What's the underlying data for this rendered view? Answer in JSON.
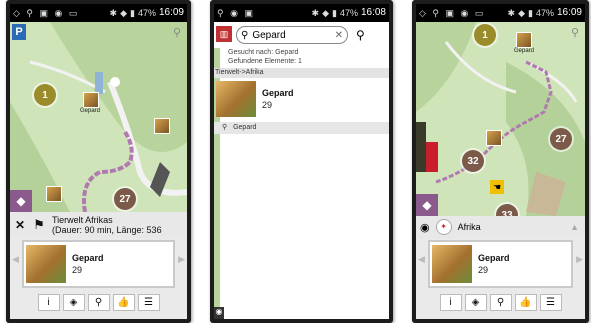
{
  "panel1": {
    "status": {
      "time": "16:09",
      "battery": "47%"
    },
    "map": {
      "markers": [
        "1",
        "27"
      ],
      "poi_label": "Gepard"
    },
    "route": {
      "close": "✕",
      "title": "Tierwelt Afrikas",
      "details": "(Dauer: 90 min, Länge: 536"
    },
    "card": {
      "name": "Gepard",
      "number": "29"
    },
    "toolbar": [
      "i",
      "◈",
      "⚲",
      "👍",
      "☰"
    ]
  },
  "panel2": {
    "status": {
      "time": "16:08",
      "battery": "47%"
    },
    "search": {
      "value": "Gepard"
    },
    "info": {
      "line1": "Gesucht nach: Gepard",
      "line2": "Gefundene Elemente: 1"
    },
    "section": "Tierwelt->Afrika",
    "result": {
      "name": "Gepard",
      "number": "29"
    },
    "chip": "Gepard"
  },
  "panel3": {
    "status": {
      "time": "16:09",
      "battery": "47%"
    },
    "map": {
      "markers": [
        "1",
        "27",
        "32",
        "33"
      ],
      "poi_label": "Gepard"
    },
    "area": {
      "title": "Afrika"
    },
    "card": {
      "name": "Gepard",
      "number": "29"
    },
    "toolbar": [
      "i",
      "◈",
      "⚲",
      "👍",
      "☰"
    ]
  }
}
